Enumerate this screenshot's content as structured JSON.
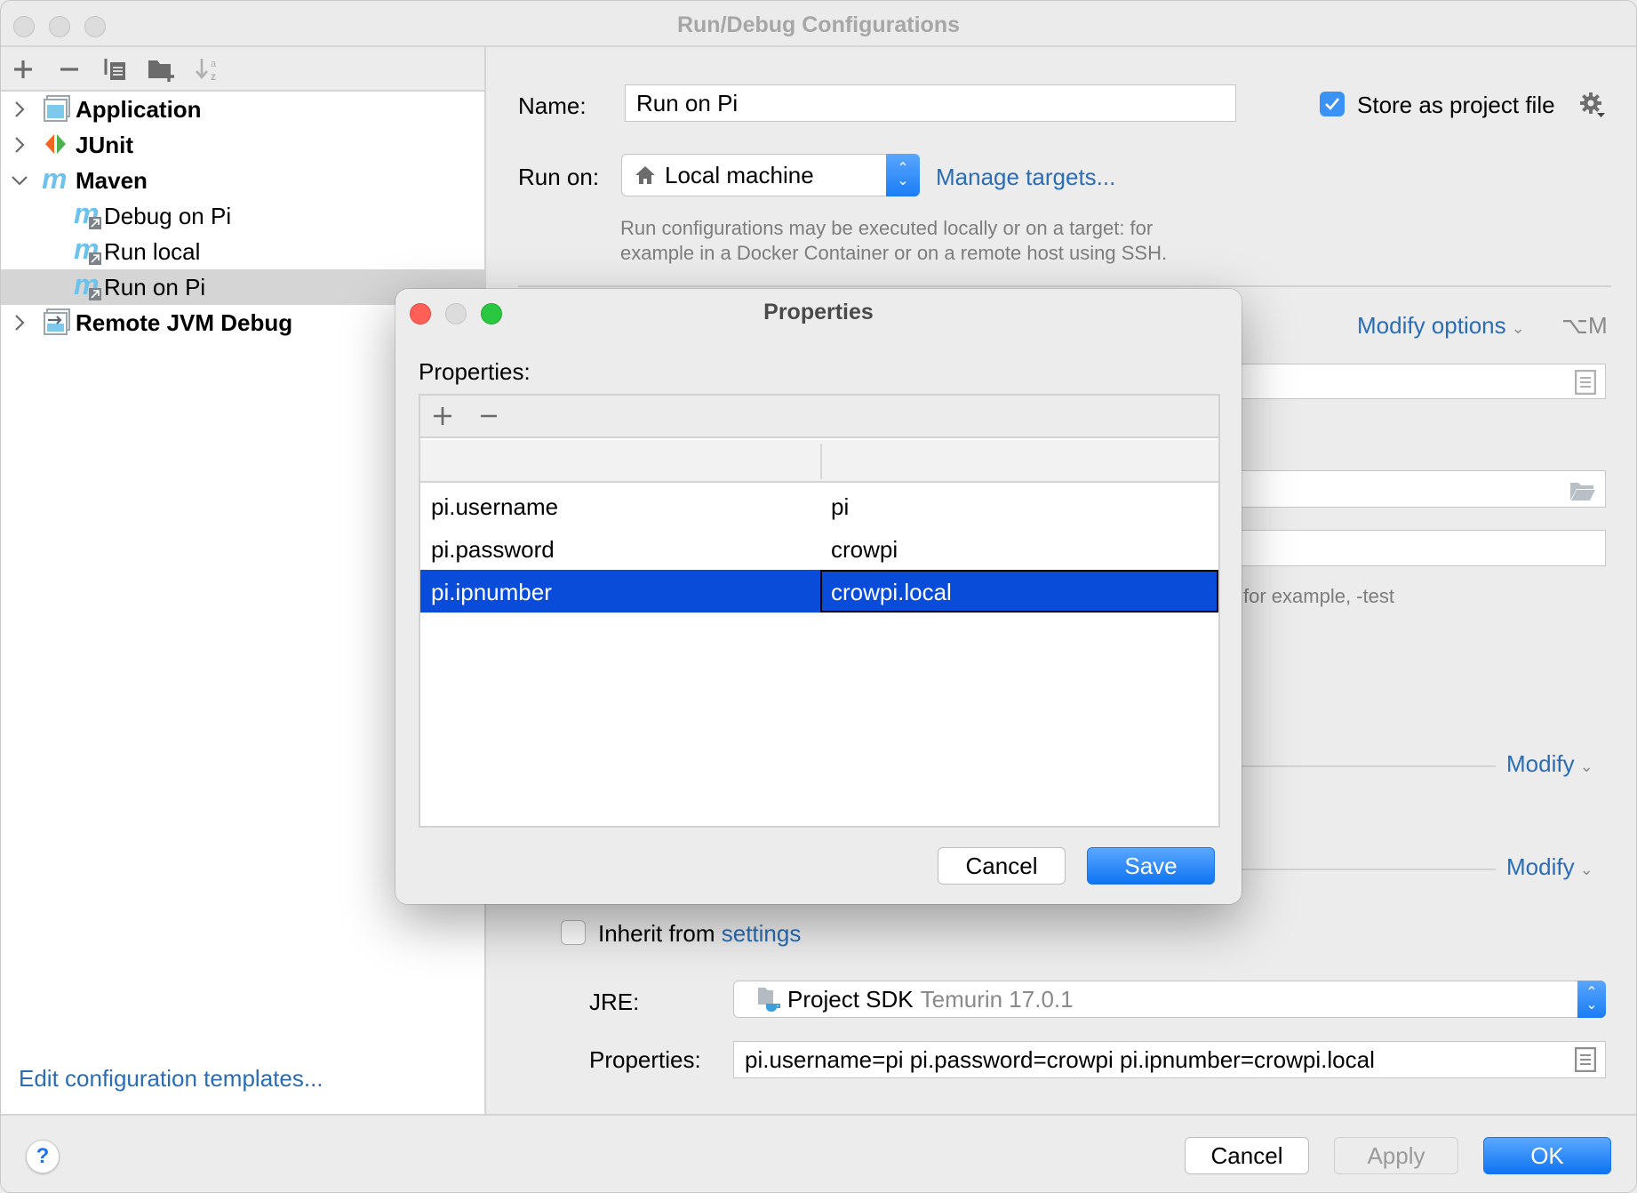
{
  "window": {
    "title": "Run/Debug Configurations"
  },
  "sidebar": {
    "toolbar": [
      {
        "icon": "add-icon",
        "glyph": "+"
      },
      {
        "icon": "remove-icon",
        "glyph": "−"
      },
      {
        "icon": "copy-icon",
        "glyph": "⧉"
      },
      {
        "icon": "new-folder-icon",
        "glyph": "▰"
      },
      {
        "icon": "sort-alpha-icon",
        "glyph": "↓ᵃz"
      }
    ],
    "tree": [
      {
        "label": "Application",
        "level": 0,
        "expanded": false,
        "bold": true,
        "icon": "application-icon"
      },
      {
        "label": "JUnit",
        "level": 0,
        "expanded": false,
        "bold": true,
        "icon": "junit-icon"
      },
      {
        "label": "Maven",
        "level": 0,
        "expanded": true,
        "bold": true,
        "icon": "maven-icon"
      },
      {
        "label": "Debug on Pi",
        "level": 1,
        "bold": false,
        "icon": "maven-run-config-icon"
      },
      {
        "label": "Run local",
        "level": 1,
        "bold": false,
        "icon": "maven-run-config-icon"
      },
      {
        "label": "Run on Pi",
        "level": 1,
        "bold": false,
        "icon": "maven-run-config-icon",
        "selected": true
      },
      {
        "label": "Remote JVM Debug",
        "level": 0,
        "expanded": false,
        "bold": true,
        "icon": "remote-debug-icon"
      }
    ],
    "edit_templates_link": "Edit configuration templates..."
  },
  "form": {
    "name_label": "Name:",
    "name_value": "Run on Pi",
    "store_as_project_file_label": "Store as project file",
    "store_as_project_file_checked": true,
    "run_on_label": "Run on:",
    "run_on_value": "Local machine",
    "manage_targets_link": "Manage targets...",
    "run_on_hint_line1": "Run configurations may be executed locally or on a target: for",
    "run_on_hint_line2": "example in a Docker Container or on a remote host using SSH.",
    "modify_options_label": "Modify options",
    "modify_options_shortcut": "⌥M",
    "profiles_hint": "for example, -test",
    "modify_label_1": "Modify",
    "modify_label_2": "Modify",
    "inherit_label": "Inherit from",
    "inherit_link": "settings",
    "inherit_checked": false,
    "jre_label": "JRE:",
    "jre_value": "Project SDK",
    "jre_detail": "Temurin 17.0.1",
    "properties_label": "Properties:",
    "properties_value": "pi.username=pi pi.password=crowpi pi.ipnumber=crowpi.local"
  },
  "footer": {
    "help_label": "?",
    "cancel_label": "Cancel",
    "apply_label": "Apply",
    "ok_label": "OK"
  },
  "properties_dialog": {
    "title": "Properties",
    "label": "Properties:",
    "add_glyph": "+",
    "remove_glyph": "−",
    "columns": [
      "",
      ""
    ],
    "rows": [
      {
        "key": "pi.username",
        "value": "pi",
        "selected": false
      },
      {
        "key": "pi.password",
        "value": "crowpi",
        "selected": false
      },
      {
        "key": "pi.ipnumber",
        "value": "crowpi.local",
        "selected": true
      }
    ],
    "cancel_label": "Cancel",
    "save_label": "Save"
  },
  "colors": {
    "accent": "#1a7cf5",
    "link": "#2a6db4",
    "selection": "#084cd9",
    "close": "#fe5f57",
    "zoom": "#2ac840"
  }
}
